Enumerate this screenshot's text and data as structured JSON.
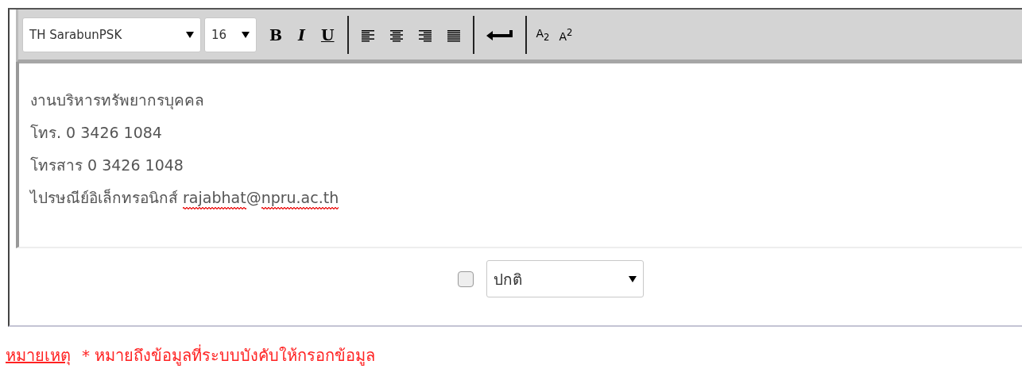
{
  "toolbar": {
    "font_select": {
      "value": "TH SarabunPSK"
    },
    "size_select": {
      "value": "16"
    },
    "format_buttons": [
      {
        "kind": "bold",
        "label": "B"
      },
      {
        "kind": "italic",
        "label": "I"
      },
      {
        "kind": "underline",
        "label": "U"
      }
    ],
    "align_buttons": [
      {
        "kind": "left"
      },
      {
        "kind": "center"
      },
      {
        "kind": "right"
      },
      {
        "kind": "justify"
      }
    ],
    "script_buttons": [
      {
        "label": "A$_{2}$"
      },
      {
        "label": "A$^{2}$"
      }
    ]
  },
  "editor": {
    "lines": [
      [
        {
          "text": "งานบริหารทรัพยากรบุคคล",
          "misspelled": false
        }
      ],
      [
        {
          "text": "โทร. 0 3426 1084",
          "misspelled": false
        }
      ],
      [
        {
          "text": "โทรสาร 0 3426 1048",
          "misspelled": false
        }
      ],
      [
        {
          "text": "ไปรษณีย์อิเล็กทรอนิกส์ ",
          "misspelled": false
        },
        {
          "text": "rajabhat",
          "misspelled": true
        },
        {
          "text": "@",
          "misspelled": false
        },
        {
          "text": "npru.ac.th",
          "misspelled": true
        }
      ]
    ]
  },
  "options": {
    "checkbox": {
      "checked": false
    },
    "status_select": {
      "value": "ปกติ"
    }
  },
  "note": {
    "label": "หมายเหตุ",
    "text": "* หมายถึงข้อมูลที่ระบบบังคับให้กรอกข้อมูล"
  }
}
